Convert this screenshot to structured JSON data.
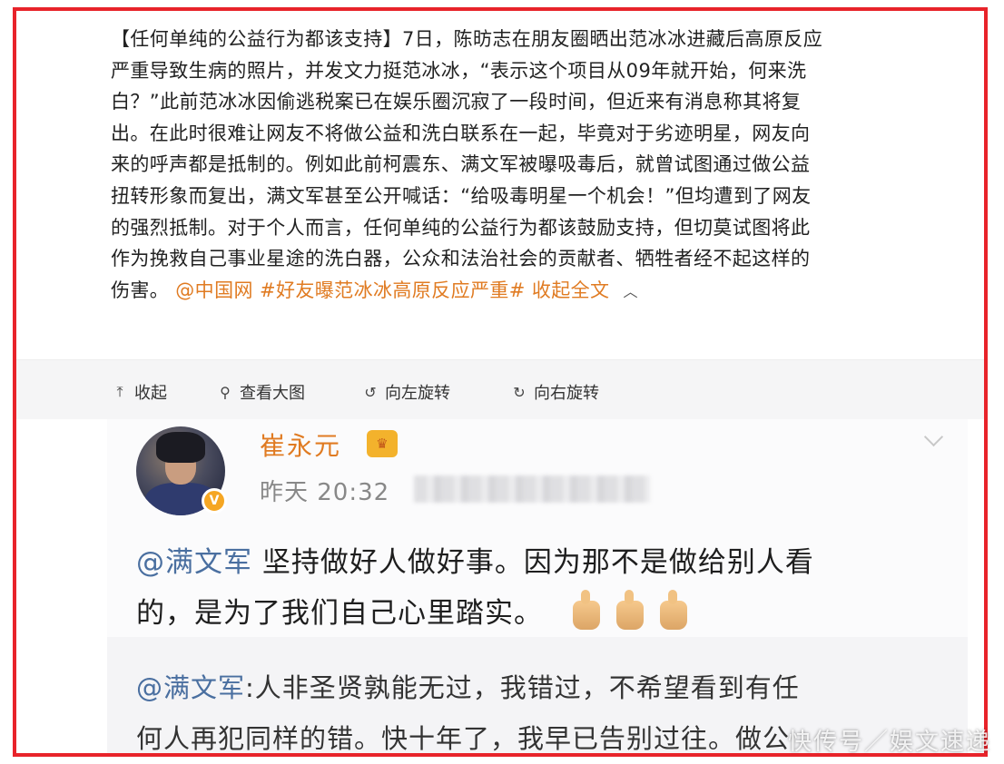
{
  "post": {
    "lines": [
      "【任何单纯的公益行为都该支持】7日，陈昉志在朋友圈晒出范冰冰进藏后高原反应",
      "严重导致生病的照片，并发文力挺范冰冰，“表示这个项目从09年就开始，何来洗",
      "白？”此前范冰冰因偷逃税案已在娱乐圈沉寂了一段时间，但近来有消息称其将复",
      "出。在此时很难让网友不将做公益和洗白联系在一起，毕竟对于劣迹明星，网友向",
      "来的呼声都是抵制的。例如此前柯震东、满文军被曝吸毒后，就曾试图通过做公益",
      "扭转形象而复出，满文军甚至公开喊话：“给吸毒明星一个机会！”但均遭到了网友",
      "的强烈抵制。对于个人而言，任何单纯的公益行为都该鼓励支持，但切莫试图将此",
      "作为挽救自己事业星途的洗白器，公众和法治社会的贡献者、牺牲者经不起这样的"
    ],
    "last_line_prefix": "伤害。",
    "source_link": "@中国网",
    "hashtag": "#好友曝范冰冰高原反应严重#",
    "collapse_label": "收起全文",
    "collapse_icon": "^"
  },
  "toolbar": {
    "collapse": {
      "label": "收起",
      "icon": "collapse-up-icon"
    },
    "view_large": {
      "label": "查看大图",
      "icon": "magnifier-icon"
    },
    "rotate_left": {
      "label": "向左旋转",
      "icon": "rotate-left-icon"
    },
    "rotate_right": {
      "label": "向右旋转",
      "icon": "rotate-right-icon"
    }
  },
  "comment": {
    "user_name": "崔永元",
    "verified_badge": "V",
    "member_badge": "👑",
    "time": "昨天 20:32",
    "reply1_mention": "@满文军",
    "reply1_text_line1": " 坚持做好人做好事。因为那不是做给别人看",
    "reply1_text_line2": "的，是为了我们自己心里踏实。",
    "reply2_mention": "@满文军",
    "reply2_text_line1": ":人非圣贤孰能无过，我错过，不希望看到有任",
    "reply2_text_line2": "何人再犯同样的错。快十年了，我早已告别过往。做公"
  },
  "watermark": "快传号／娱文速递",
  "colors": {
    "frame_border": "#e8232a",
    "link_orange": "#e07b22",
    "mention_blue": "#4a6fa0"
  }
}
